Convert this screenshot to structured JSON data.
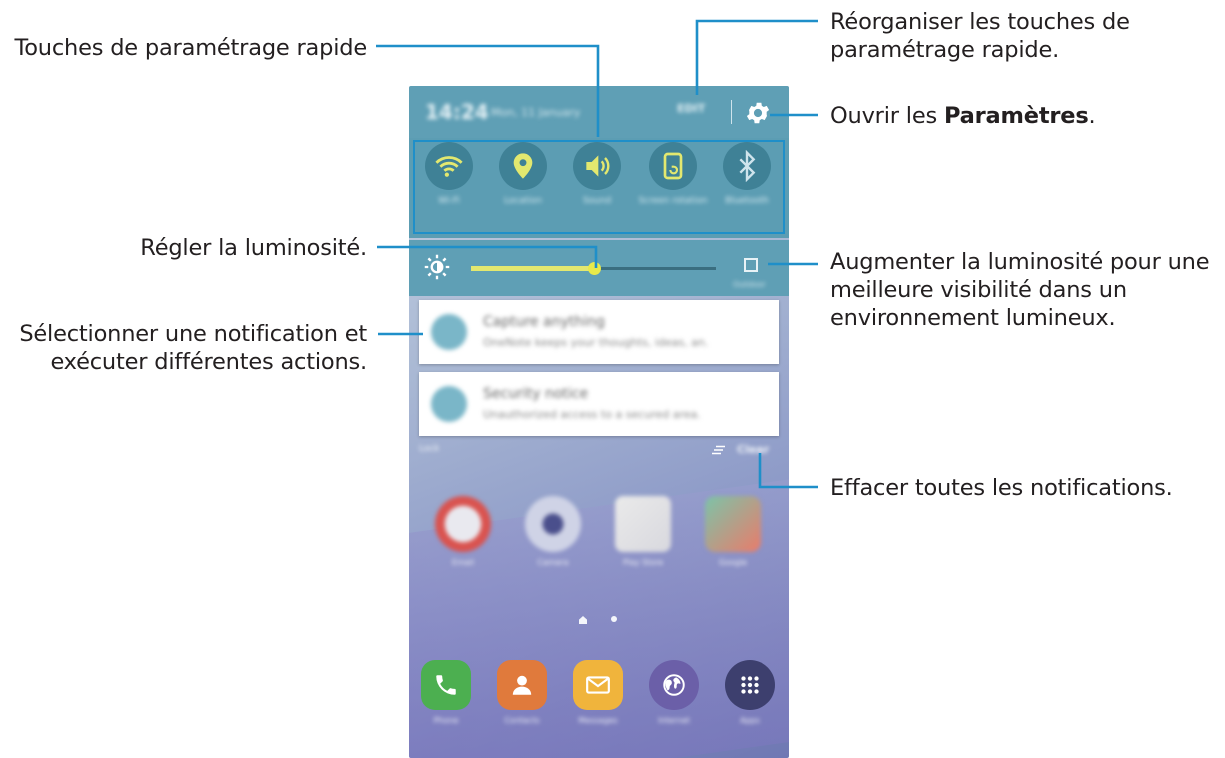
{
  "callouts": {
    "quick_settings_buttons": "Touches de paramétrage rapide",
    "rearrange_line1": "Réorganiser les touches de",
    "rearrange_line2": "paramétrage rapide.",
    "open_settings_prefix": "Ouvrir les ",
    "open_settings_bold": "Paramètres",
    "open_settings_suffix": ".",
    "adjust_brightness": "Régler la luminosité.",
    "outdoor_line1": "Augmenter la luminosité pour une",
    "outdoor_line2": "meilleure visibilité dans un",
    "outdoor_line3": "environnement lumineux.",
    "select_notif_line1": "Sélectionner une notification et",
    "select_notif_line2": "exécuter différentes actions.",
    "clear_all": "Effacer toutes les notifications."
  },
  "phone": {
    "status": {
      "time": "14:24",
      "date": "Mon, 11 January",
      "edit": "EDIT"
    },
    "quick_settings": [
      {
        "label": "Wi-Fi",
        "icon": "wifi-icon",
        "active": true
      },
      {
        "label": "Location",
        "icon": "location-icon",
        "active": true
      },
      {
        "label": "Sound",
        "icon": "sound-icon",
        "active": true
      },
      {
        "label": "Screen rotation",
        "icon": "screen-rotation-icon",
        "active": true
      },
      {
        "label": "Bluetooth",
        "icon": "bluetooth-icon",
        "active": false
      }
    ],
    "brightness": {
      "level": 0.5,
      "outdoor_label": "Outdoor"
    },
    "notifications": [
      {
        "title": "Capture anything",
        "body": "OneNote keeps your thoughts, ideas, an."
      },
      {
        "title": "Security notice",
        "body": "Unauthorized access to a secured area."
      }
    ],
    "notif_footer": {
      "left": "Lock",
      "clear": "Clear"
    },
    "apps": [
      {
        "label": "Email"
      },
      {
        "label": "Camera"
      },
      {
        "label": "Play Store"
      },
      {
        "label": "Google"
      }
    ],
    "dock": [
      {
        "label": "Phone"
      },
      {
        "label": "Contacts"
      },
      {
        "label": "Messages"
      },
      {
        "label": "Internet"
      },
      {
        "label": "Apps"
      }
    ]
  },
  "colors": {
    "accent_line": "#1f8fc9",
    "panel": "#5f9fb5",
    "qs_active": "#e3e86f"
  }
}
